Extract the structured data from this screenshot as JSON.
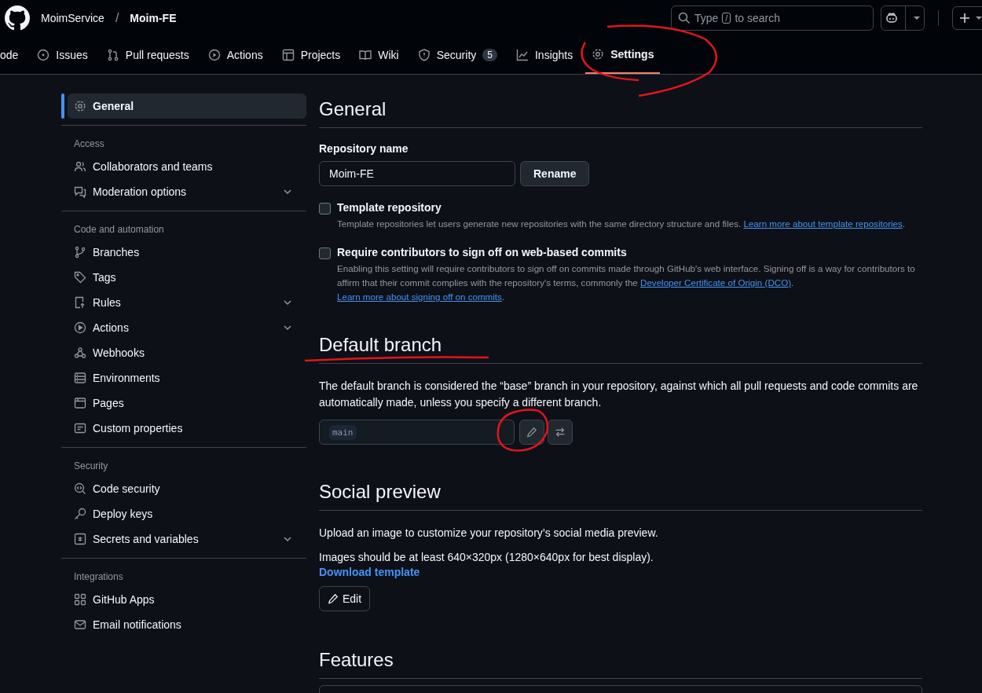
{
  "header": {
    "owner": "MoimService",
    "separator": "/",
    "repo": "Moim-FE",
    "search": {
      "placeholder_before": "Type",
      "key": "/",
      "placeholder_after": "to search"
    }
  },
  "tabs": [
    {
      "label": "ode",
      "selected": false
    },
    {
      "label": "Issues",
      "selected": false
    },
    {
      "label": "Pull requests",
      "selected": false
    },
    {
      "label": "Actions",
      "selected": false
    },
    {
      "label": "Projects",
      "selected": false
    },
    {
      "label": "Wiki",
      "selected": false
    },
    {
      "label": "Security",
      "selected": false,
      "count": "5"
    },
    {
      "label": "Insights",
      "selected": false
    },
    {
      "label": "Settings",
      "selected": true
    }
  ],
  "sidebar": [
    {
      "items": [
        {
          "label": "General",
          "selected": true,
          "expandable": false
        }
      ]
    },
    {
      "heading": "Access",
      "items": [
        {
          "label": "Collaborators and teams",
          "selected": false,
          "expandable": false
        },
        {
          "label": "Moderation options",
          "selected": false,
          "expandable": true
        }
      ]
    },
    {
      "heading": "Code and automation",
      "items": [
        {
          "label": "Branches",
          "selected": false,
          "expandable": false
        },
        {
          "label": "Tags",
          "selected": false,
          "expandable": false
        },
        {
          "label": "Rules",
          "selected": false,
          "expandable": true
        },
        {
          "label": "Actions",
          "selected": false,
          "expandable": true
        },
        {
          "label": "Webhooks",
          "selected": false,
          "expandable": false
        },
        {
          "label": "Environments",
          "selected": false,
          "expandable": false
        },
        {
          "label": "Pages",
          "selected": false,
          "expandable": false
        },
        {
          "label": "Custom properties",
          "selected": false,
          "expandable": false
        }
      ]
    },
    {
      "heading": "Security",
      "items": [
        {
          "label": "Code security",
          "selected": false,
          "expandable": false
        },
        {
          "label": "Deploy keys",
          "selected": false,
          "expandable": false
        },
        {
          "label": "Secrets and variables",
          "selected": false,
          "expandable": true
        }
      ]
    },
    {
      "heading": "Integrations",
      "items": [
        {
          "label": "GitHub Apps",
          "selected": false,
          "expandable": false
        },
        {
          "label": "Email notifications",
          "selected": false,
          "expandable": false
        }
      ]
    }
  ],
  "general": {
    "title": "General",
    "repo_name_label": "Repository name",
    "repo_name_value": "Moim-FE",
    "rename_button": "Rename",
    "options": [
      {
        "label": "Template repository",
        "checked": false,
        "description": [
          {
            "text": "Template repositories let users generate new repositories with the same directory structure and files. "
          },
          {
            "link": "Learn more about template repositories"
          },
          {
            "text": "."
          }
        ]
      },
      {
        "label": "Require contributors to sign off on web-based commits",
        "checked": false,
        "description": [
          {
            "text": "Enabling this setting will require contributors to sign off on commits made through GitHub's web interface. Signing off is a way for contributors to affirm that their commit complies with the repository's terms, commonly the "
          },
          {
            "link": "Developer Certificate of Origin (DCO)"
          },
          {
            "text": ". "
          },
          {
            "link": "Learn more about signing off on commits"
          },
          {
            "text": "."
          }
        ]
      }
    ]
  },
  "default_branch": {
    "title": "Default branch",
    "text": "The default branch is considered the “base” branch in your repository, against which all pull requests and code commits are automatically made, unless you specify a different branch.",
    "branch": "main"
  },
  "social_preview": {
    "title": "Social preview",
    "text_1": "Upload an image to customize your repository’s social media preview.",
    "text_2": "Images should be at least 640×320px (1280×640px for best display).",
    "link": "Download template",
    "edit_button": "Edit"
  },
  "features": {
    "title": "Features"
  }
}
